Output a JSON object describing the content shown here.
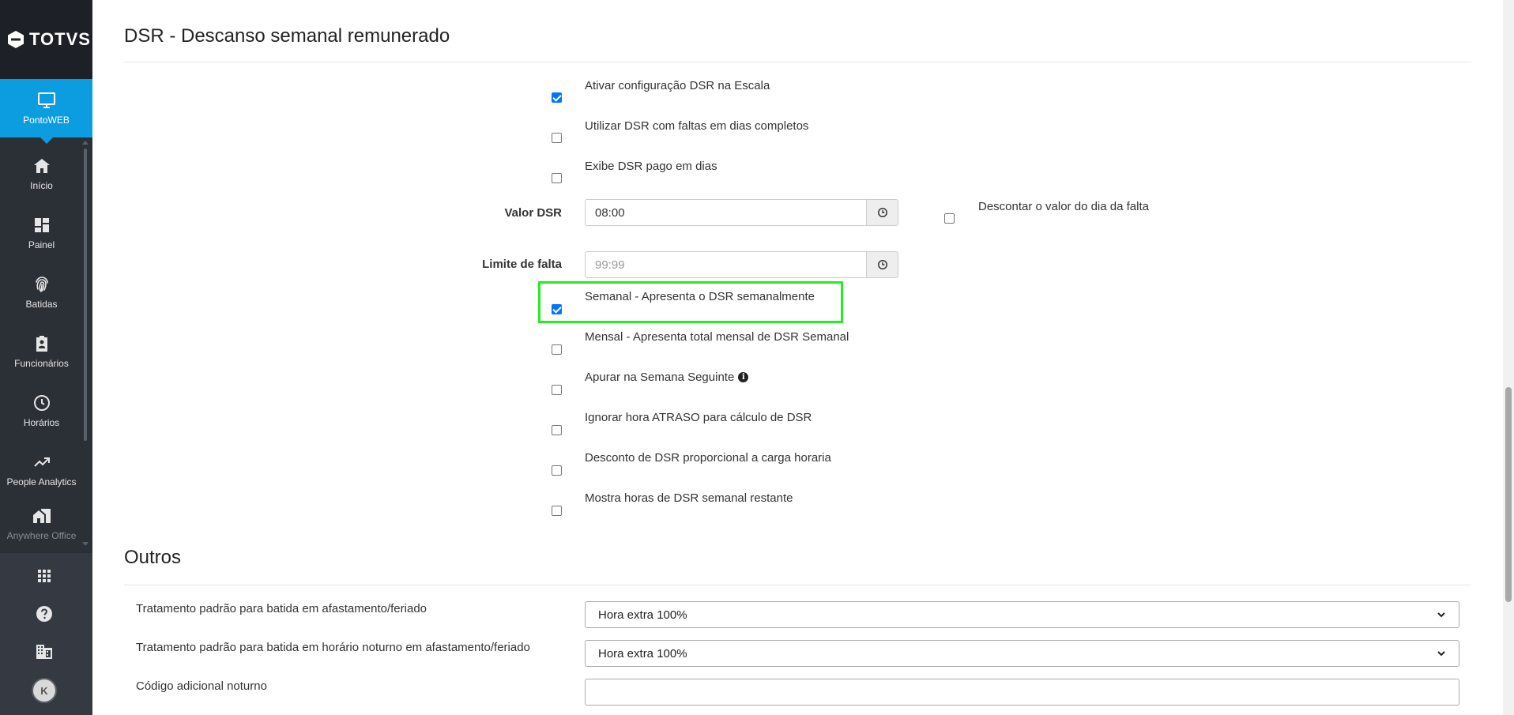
{
  "sidebar": {
    "logo_text": "TOTVS",
    "active_item": {
      "label": "PontoWEB",
      "icon": "monitor-icon"
    },
    "items": [
      {
        "label": "Início",
        "icon": "home-icon"
      },
      {
        "label": "Painel",
        "icon": "dashboard-icon"
      },
      {
        "label": "Batidas",
        "icon": "fingerprint-icon"
      },
      {
        "label": "Funcionários",
        "icon": "badge-icon"
      },
      {
        "label": "Horários",
        "icon": "clock-icon"
      },
      {
        "label": "People Analytics",
        "icon": "trending-up-icon"
      },
      {
        "label": "Anywhere Office",
        "icon": "home-work-icon"
      }
    ],
    "bottom": {
      "apps_icon": "apps-grid-icon",
      "help_icon": "help-circle-icon",
      "company_icon": "building-icon",
      "avatar_initial": "K"
    }
  },
  "dsr_section": {
    "title": "DSR - Descanso semanal remunerado",
    "checkboxes_top": [
      {
        "label": "Ativar configuração DSR na Escala",
        "checked": true
      },
      {
        "label": "Utilizar DSR com faltas em dias completos",
        "checked": false
      },
      {
        "label": "Exibe DSR pago em dias",
        "checked": false
      }
    ],
    "valor_dsr": {
      "label": "Valor DSR",
      "value": "08:00",
      "icon": "clock-icon"
    },
    "descontar": {
      "label": "Descontar o valor do dia da falta",
      "checked": false
    },
    "limite_falta": {
      "label": "Limite de falta",
      "placeholder": "99:99",
      "icon": "clock-icon"
    },
    "checkboxes_bottom": [
      {
        "label": "Semanal - Apresenta o DSR semanalmente",
        "checked": true,
        "highlighted": true
      },
      {
        "label": "Mensal - Apresenta total mensal de DSR Semanal",
        "checked": false
      },
      {
        "label": "Apurar na Semana Seguinte",
        "checked": false,
        "info_icon": "info-icon"
      },
      {
        "label": "Ignorar hora ATRASO para cálculo de DSR",
        "checked": false
      },
      {
        "label": "Desconto de DSR proporcional a carga horaria",
        "checked": false
      },
      {
        "label": "Mostra horas de DSR semanal restante",
        "checked": false
      }
    ]
  },
  "outros_section": {
    "title": "Outros",
    "rows": [
      {
        "label": "Tratamento padrão para batida em afastamento/feriado",
        "value": "Hora extra 100%"
      },
      {
        "label": "Tratamento padrão para batida em horário noturno em afastamento/feriado",
        "value": "Hora extra 100%"
      },
      {
        "label": "Código adicional noturno",
        "value": ""
      }
    ]
  },
  "colors": {
    "sidebar_bg": "#2b2f36",
    "active_blue": "#0c9ce0",
    "checkbox_blue": "#0075ff",
    "highlight_green": "#22ee22"
  }
}
